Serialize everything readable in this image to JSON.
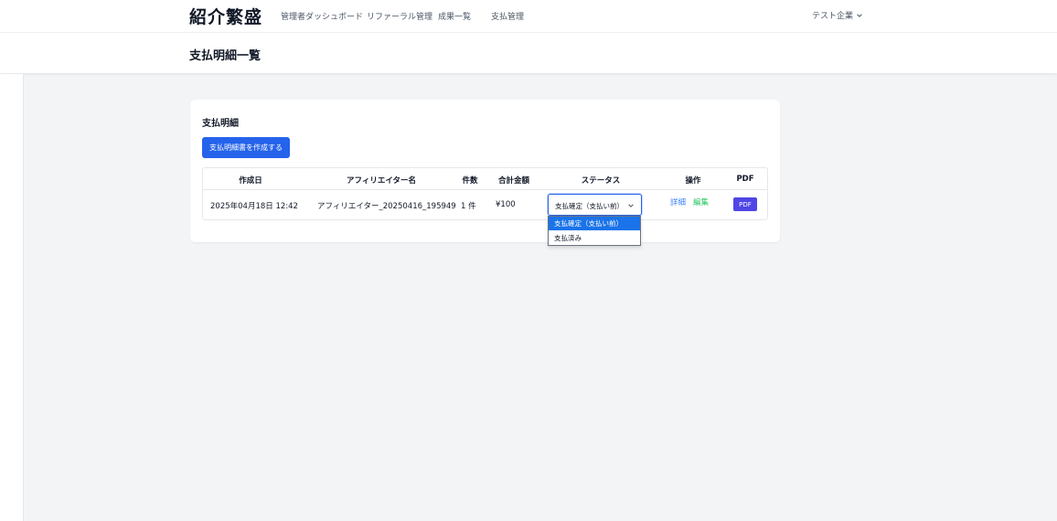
{
  "nav": {
    "brand": "紹介繁盛",
    "links": [
      "管理者ダッシュボード",
      "リファーラル管理",
      "成果一覧",
      "支払管理"
    ],
    "user_menu": "テスト企業"
  },
  "page": {
    "title": "支払明細一覧"
  },
  "card": {
    "title": "支払明細",
    "create_button": "支払明細書を作成する"
  },
  "table": {
    "headers": [
      "作成日",
      "アフィリエイター名",
      "件数",
      "合計金額",
      "ステータス",
      "操作",
      "PDF"
    ],
    "rows": [
      {
        "created_at": "2025年04月18日 12:42",
        "affiliator": "アフィリエイター_20250416_195949",
        "count": "1 件",
        "total": "¥100",
        "status": "支払確定（支払い前）",
        "action_detail": "詳細",
        "action_edit": "編集",
        "pdf": "PDF"
      }
    ]
  },
  "status_dropdown": {
    "options": [
      "支払確定（支払い前）",
      "支払済み"
    ],
    "selected": "支払確定（支払い前）"
  },
  "colors": {
    "primary": "#2563eb",
    "pdf": "#4f46e5",
    "link_detail": "#3b82f6",
    "link_edit": "#22c55e",
    "dropdown_highlight": "#1a73e8"
  },
  "icons": {
    "user_menu_chevron": "chevron-down-icon",
    "select_chevron": "chevron-down-icon"
  }
}
